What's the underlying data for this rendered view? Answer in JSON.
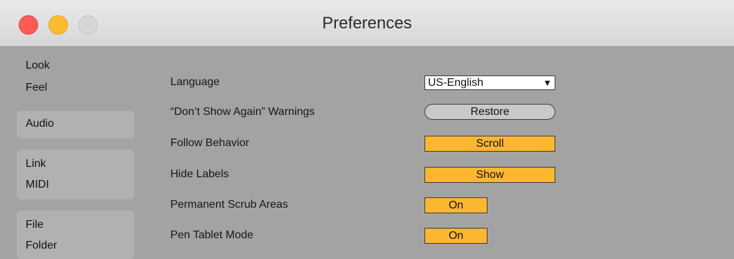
{
  "window": {
    "title": "Preferences"
  },
  "sidebar": {
    "groups": [
      {
        "items": [
          "Look",
          "Feel"
        ],
        "active": true
      },
      {
        "items": [
          "Audio"
        ],
        "active": false
      },
      {
        "items": [
          "Link",
          "MIDI"
        ],
        "active": false
      },
      {
        "items": [
          "File",
          "Folder"
        ],
        "active": false
      }
    ]
  },
  "settings": {
    "language": {
      "label": "Language",
      "value": "US-English"
    },
    "warnings": {
      "label": "“Don’t Show Again” Warnings",
      "button": "Restore"
    },
    "follow": {
      "label": "Follow Behavior",
      "value": "Scroll"
    },
    "hide_labels": {
      "label": "Hide Labels",
      "value": "Show"
    },
    "scrub": {
      "label": "Permanent Scrub Areas",
      "value": "On"
    },
    "pen": {
      "label": "Pen Tablet Mode",
      "value": "On"
    }
  },
  "colors": {
    "toggle_active": "#fbb730",
    "window_bg": "#a3a3a3",
    "close": "#fc5b57",
    "minimize": "#fdbc2e"
  },
  "icons": {
    "dropdown": "triangle-down"
  }
}
